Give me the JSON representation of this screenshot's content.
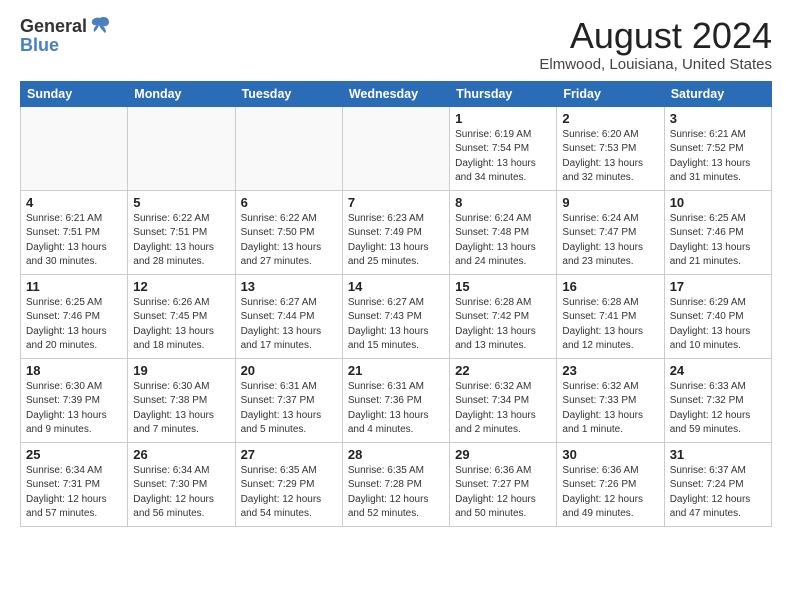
{
  "header": {
    "logo_general": "General",
    "logo_blue": "Blue",
    "month_year": "August 2024",
    "location": "Elmwood, Louisiana, United States"
  },
  "weekdays": [
    "Sunday",
    "Monday",
    "Tuesday",
    "Wednesday",
    "Thursday",
    "Friday",
    "Saturday"
  ],
  "weeks": [
    [
      {
        "day": "",
        "detail": ""
      },
      {
        "day": "",
        "detail": ""
      },
      {
        "day": "",
        "detail": ""
      },
      {
        "day": "",
        "detail": ""
      },
      {
        "day": "1",
        "detail": "Sunrise: 6:19 AM\nSunset: 7:54 PM\nDaylight: 13 hours\nand 34 minutes."
      },
      {
        "day": "2",
        "detail": "Sunrise: 6:20 AM\nSunset: 7:53 PM\nDaylight: 13 hours\nand 32 minutes."
      },
      {
        "day": "3",
        "detail": "Sunrise: 6:21 AM\nSunset: 7:52 PM\nDaylight: 13 hours\nand 31 minutes."
      }
    ],
    [
      {
        "day": "4",
        "detail": "Sunrise: 6:21 AM\nSunset: 7:51 PM\nDaylight: 13 hours\nand 30 minutes."
      },
      {
        "day": "5",
        "detail": "Sunrise: 6:22 AM\nSunset: 7:51 PM\nDaylight: 13 hours\nand 28 minutes."
      },
      {
        "day": "6",
        "detail": "Sunrise: 6:22 AM\nSunset: 7:50 PM\nDaylight: 13 hours\nand 27 minutes."
      },
      {
        "day": "7",
        "detail": "Sunrise: 6:23 AM\nSunset: 7:49 PM\nDaylight: 13 hours\nand 25 minutes."
      },
      {
        "day": "8",
        "detail": "Sunrise: 6:24 AM\nSunset: 7:48 PM\nDaylight: 13 hours\nand 24 minutes."
      },
      {
        "day": "9",
        "detail": "Sunrise: 6:24 AM\nSunset: 7:47 PM\nDaylight: 13 hours\nand 23 minutes."
      },
      {
        "day": "10",
        "detail": "Sunrise: 6:25 AM\nSunset: 7:46 PM\nDaylight: 13 hours\nand 21 minutes."
      }
    ],
    [
      {
        "day": "11",
        "detail": "Sunrise: 6:25 AM\nSunset: 7:46 PM\nDaylight: 13 hours\nand 20 minutes."
      },
      {
        "day": "12",
        "detail": "Sunrise: 6:26 AM\nSunset: 7:45 PM\nDaylight: 13 hours\nand 18 minutes."
      },
      {
        "day": "13",
        "detail": "Sunrise: 6:27 AM\nSunset: 7:44 PM\nDaylight: 13 hours\nand 17 minutes."
      },
      {
        "day": "14",
        "detail": "Sunrise: 6:27 AM\nSunset: 7:43 PM\nDaylight: 13 hours\nand 15 minutes."
      },
      {
        "day": "15",
        "detail": "Sunrise: 6:28 AM\nSunset: 7:42 PM\nDaylight: 13 hours\nand 13 minutes."
      },
      {
        "day": "16",
        "detail": "Sunrise: 6:28 AM\nSunset: 7:41 PM\nDaylight: 13 hours\nand 12 minutes."
      },
      {
        "day": "17",
        "detail": "Sunrise: 6:29 AM\nSunset: 7:40 PM\nDaylight: 13 hours\nand 10 minutes."
      }
    ],
    [
      {
        "day": "18",
        "detail": "Sunrise: 6:30 AM\nSunset: 7:39 PM\nDaylight: 13 hours\nand 9 minutes."
      },
      {
        "day": "19",
        "detail": "Sunrise: 6:30 AM\nSunset: 7:38 PM\nDaylight: 13 hours\nand 7 minutes."
      },
      {
        "day": "20",
        "detail": "Sunrise: 6:31 AM\nSunset: 7:37 PM\nDaylight: 13 hours\nand 5 minutes."
      },
      {
        "day": "21",
        "detail": "Sunrise: 6:31 AM\nSunset: 7:36 PM\nDaylight: 13 hours\nand 4 minutes."
      },
      {
        "day": "22",
        "detail": "Sunrise: 6:32 AM\nSunset: 7:34 PM\nDaylight: 13 hours\nand 2 minutes."
      },
      {
        "day": "23",
        "detail": "Sunrise: 6:32 AM\nSunset: 7:33 PM\nDaylight: 13 hours\nand 1 minute."
      },
      {
        "day": "24",
        "detail": "Sunrise: 6:33 AM\nSunset: 7:32 PM\nDaylight: 12 hours\nand 59 minutes."
      }
    ],
    [
      {
        "day": "25",
        "detail": "Sunrise: 6:34 AM\nSunset: 7:31 PM\nDaylight: 12 hours\nand 57 minutes."
      },
      {
        "day": "26",
        "detail": "Sunrise: 6:34 AM\nSunset: 7:30 PM\nDaylight: 12 hours\nand 56 minutes."
      },
      {
        "day": "27",
        "detail": "Sunrise: 6:35 AM\nSunset: 7:29 PM\nDaylight: 12 hours\nand 54 minutes."
      },
      {
        "day": "28",
        "detail": "Sunrise: 6:35 AM\nSunset: 7:28 PM\nDaylight: 12 hours\nand 52 minutes."
      },
      {
        "day": "29",
        "detail": "Sunrise: 6:36 AM\nSunset: 7:27 PM\nDaylight: 12 hours\nand 50 minutes."
      },
      {
        "day": "30",
        "detail": "Sunrise: 6:36 AM\nSunset: 7:26 PM\nDaylight: 12 hours\nand 49 minutes."
      },
      {
        "day": "31",
        "detail": "Sunrise: 6:37 AM\nSunset: 7:24 PM\nDaylight: 12 hours\nand 47 minutes."
      }
    ]
  ]
}
